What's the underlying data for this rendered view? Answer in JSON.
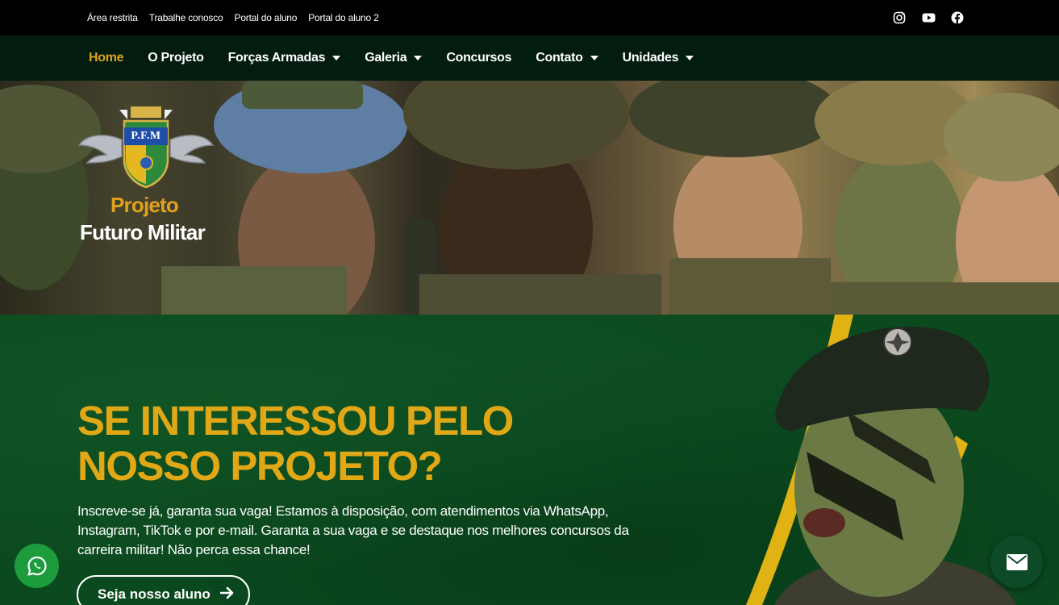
{
  "topbar": {
    "links": [
      "Área restrita",
      "Trabalhe conosco",
      "Portal do aluno",
      "Portal do aluno 2"
    ],
    "social_icons": [
      "instagram-icon",
      "youtube-icon",
      "facebook-icon"
    ]
  },
  "nav": {
    "items": [
      {
        "label": "Home",
        "active": true,
        "dropdown": false
      },
      {
        "label": "O Projeto",
        "active": false,
        "dropdown": false
      },
      {
        "label": "Forças Armadas",
        "active": false,
        "dropdown": true
      },
      {
        "label": "Galeria",
        "active": false,
        "dropdown": true
      },
      {
        "label": "Concursos",
        "active": false,
        "dropdown": false
      },
      {
        "label": "Contato",
        "active": false,
        "dropdown": true
      },
      {
        "label": "Unidades",
        "active": false,
        "dropdown": true
      }
    ]
  },
  "hero": {
    "logo_initials": "P.F.M",
    "logo_line1": "Projeto",
    "logo_line2": "Futuro Militar"
  },
  "cta": {
    "headline": "SE INTERESSOU PELO NOSSO PROJETO?",
    "paragraph": "Inscreve-se já, garanta sua vaga! Estamos à disposição, com atendimentos via WhatsApp, Instagram, TikTok e por e-mail. Garanta a sua vaga e se destaque nos melhores concursos da carreira militar! Não perca essa chance!",
    "button_label": "Seja nosso aluno"
  },
  "colors": {
    "accent": "#e0a21d",
    "nav_bg": "#031c10",
    "cta_bg": "#0b4a1f",
    "whatsapp": "#1c9c3c"
  }
}
